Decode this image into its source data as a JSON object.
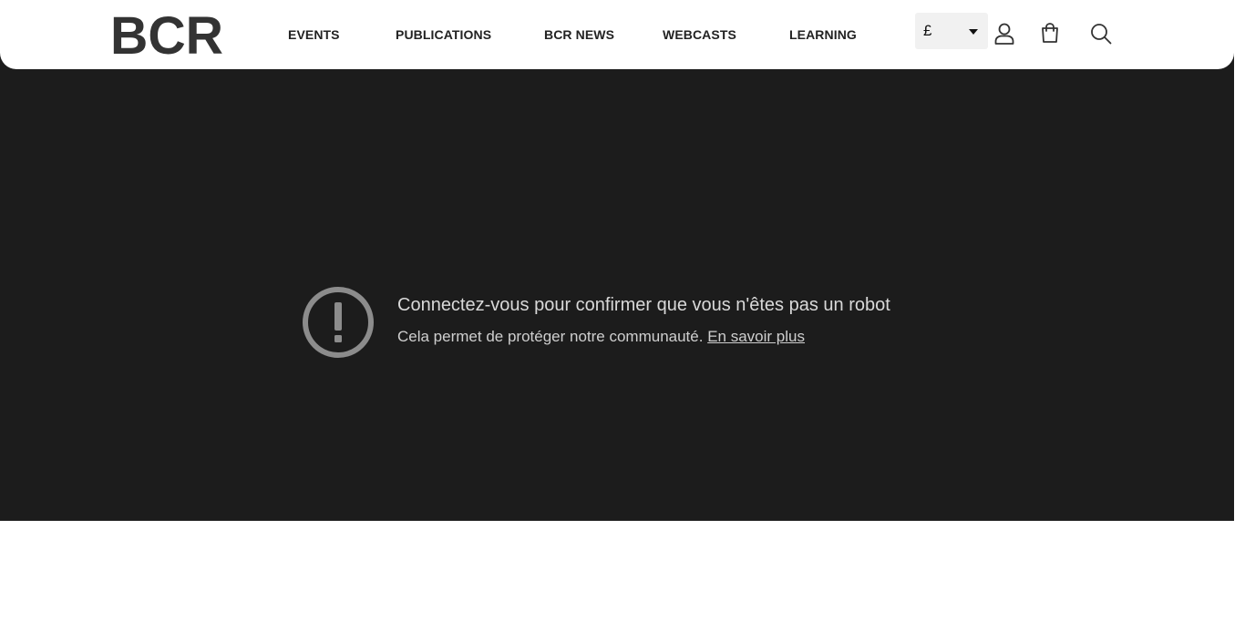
{
  "header": {
    "logo_text": "BCR",
    "nav": [
      {
        "label": "EVENTS"
      },
      {
        "label": "PUBLICATIONS"
      },
      {
        "label": "BCR NEWS"
      },
      {
        "label": "WEBCASTS"
      },
      {
        "label": "LEARNING"
      }
    ],
    "currency": {
      "selected": "£"
    },
    "icons": {
      "account": "user-icon",
      "cart": "shopping-bag-icon",
      "search": "search-icon"
    }
  },
  "embed_notice": {
    "icon": "exclamation-circle-icon",
    "title": "Connectez-vous pour confirmer que vous n'êtes pas un robot",
    "text": "Cela permet de protéger notre communauté.",
    "link_label": "En savoir plus"
  },
  "colors": {
    "embed_background": "#1c1c1c",
    "header_background": "#ffffff",
    "nav_text": "#222222",
    "notice_text": "#d9d9d9"
  }
}
